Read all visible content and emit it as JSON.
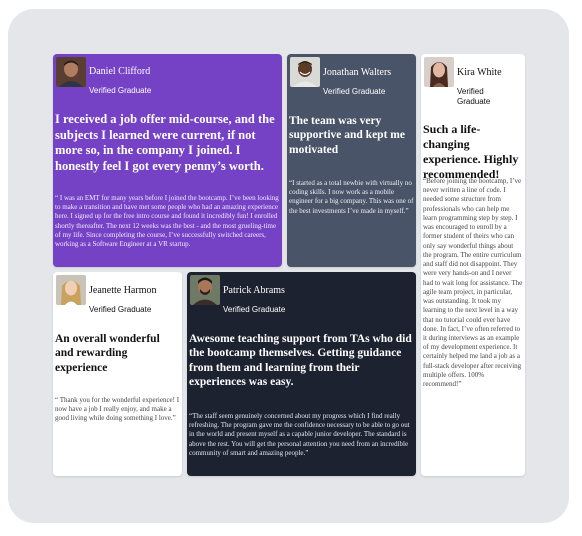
{
  "testimonials": [
    {
      "name": "Daniel Clifford",
      "status": "Verified Graduate",
      "headline": "I received a job offer mid-course, and the subjects I learned were current, if not more so, in the company I joined. I honestly feel I got every penny’s worth.",
      "quote": "“ I was an EMT for many years before I joined the bootcamp. I’ve been looking to make a transition and have met some people who had an amazing experience here. I signed up for the free intro course and found it incredibly fun! I enrolled shortly thereafter. The next 12 weeks was the best - and the most grueling-time of my life. Since completing the course, I’ve successfully switched careers, working as a Software Engineer at a VR startup.",
      "bg": "#7542c6",
      "avatar_icon": "man-portrait-icon"
    },
    {
      "name": "Jonathan Walters",
      "status": "Verified Graduate",
      "headline": "The team was very supportive and kept me motivated",
      "quote": "“I started as a total newbie with virtually no coding skills. I now work as a mobile engineer for a big company. This was one of the best investments I’ve made in myself.”",
      "bg": "#4a5468",
      "avatar_icon": "man-portrait-icon"
    },
    {
      "name": "Kira Whitе",
      "status": "Verified Graduate",
      "headline": "Such a life-changing experience. Highly recommended!",
      "quote": "“Before joining the bootcamp, I’ve never written a line of code. I needed some structure from professionals who can help me learn programming step by step. I was encouraged to enroll by a former student of theirs who can only say wonderful things about the program. The entire curriculum and staff did not disappoint. They were very hands-on and I never had to wait long for assistance. The agile team project, in particular, was outstanding. It took my learning to the next level in a way that no tutorial could ever have done. In fact, I’ve often referred to it during interviews as an example of my development experience. It certainly helped me land a job as a full-stack developer after receiving multiple offers. 100% recommend!”",
      "bg": "#ffffff",
      "avatar_icon": "woman-portrait-icon"
    },
    {
      "name": "Jeanette Harmon",
      "status": "Verified Graduate",
      "headline": "An overall wonderful and rewarding experience",
      "quote": "“ Thank you for the wonderful experience! I now have a job I really enjoy, and make a good living while doing something I love.”",
      "bg": "#ffffff",
      "avatar_icon": "woman-portrait-icon"
    },
    {
      "name": "Patrick Abrams",
      "status": "Verified Graduate",
      "headline": "Awesome teaching support from TAs who did the bootcamp themselves. Getting guidance from them and learning from their experiences was easy.",
      "quote": "“The staff seem genuinely concerned about my progress which I find really refreshing. The program gave me the confidence necessary to be able to go out in the world and present myself as a capable junior developer. The standard is above the rest. You will get the personal attention you need from an incredible community of smart and amazing people.”",
      "bg": "#1c2230",
      "avatar_icon": "man-portrait-icon"
    }
  ]
}
